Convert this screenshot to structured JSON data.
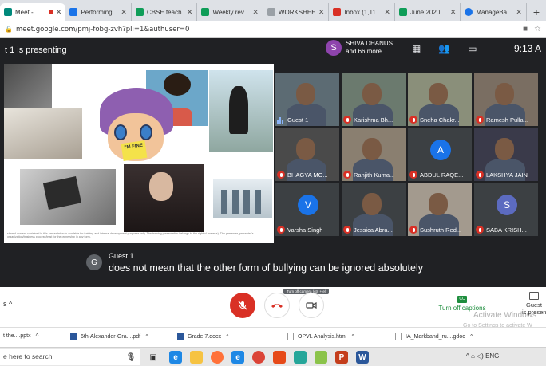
{
  "browser": {
    "tabs": [
      {
        "title": "Meet - ",
        "recording": true,
        "favicon_color": "#00897b",
        "active": true
      },
      {
        "title": "Performing",
        "favicon_color": "#1a73e8"
      },
      {
        "title": "CBSE teach",
        "favicon_color": "#0f9d58"
      },
      {
        "title": "Weekly rev",
        "favicon_color": "#0f9d58"
      },
      {
        "title": "WORKSHEE",
        "favicon_color": "#9aa0a6"
      },
      {
        "title": "Inbox (1,11",
        "favicon_color": "#d93025"
      },
      {
        "title": "June 2020",
        "favicon_color": "#0f9d58"
      },
      {
        "title": "ManageBa",
        "favicon_color": "#1a73e8"
      }
    ],
    "new_tab": "+",
    "url": "meet.google.com/pmj-fobg-zvh?pli=1&authuser=0"
  },
  "meet": {
    "presenting_label": "t 1 is presenting",
    "presenter": {
      "initial": "S",
      "name": "SHIVA DHANUS...",
      "more": "and 66 more"
    },
    "time": "9:13 A",
    "shared_caption": "shared content contained in this presentation is available for training and internal development purposes only. The training presentation belongs to the rightful owner(s). The presenter, presenter's organization/business process/trust for the ownership in any form.",
    "fine_card": "I'M FINE",
    "participants": [
      {
        "name": "Guest 1",
        "muted": false,
        "type": "video",
        "color": "#5c6b73"
      },
      {
        "name": "Karishma Bh...",
        "muted": true,
        "type": "video",
        "color": "#6b7a6e"
      },
      {
        "name": "Sneha Chakr...",
        "muted": true,
        "type": "video",
        "color": "#8a8f7a"
      },
      {
        "name": "Ramesh Pulla...",
        "muted": true,
        "type": "video",
        "color": "#7a6e62"
      },
      {
        "name": "BHAGYA MO...",
        "muted": true,
        "type": "video",
        "color": "#4a4a4a"
      },
      {
        "name": "Ranjith Kuma...",
        "muted": true,
        "type": "video",
        "color": "#8a7f70"
      },
      {
        "name": "ABDUL RAQE...",
        "muted": true,
        "type": "avatar",
        "initial": "A",
        "color": "#1a73e8"
      },
      {
        "name": "LAKSHYA JAIN",
        "muted": true,
        "type": "video",
        "color": "#3a3a4a"
      },
      {
        "name": "Varsha Singh",
        "muted": true,
        "type": "avatar",
        "initial": "V",
        "color": "#1a73e8"
      },
      {
        "name": "Jessica Abra...",
        "muted": true,
        "type": "video",
        "color": "#3c4043"
      },
      {
        "name": "Sushruth Red...",
        "muted": true,
        "type": "video",
        "color": "#a39a8e"
      },
      {
        "name": "SABA KRISH...",
        "muted": true,
        "type": "avatar",
        "initial": "S",
        "color": "#5c6bc0"
      }
    ],
    "caption": {
      "initial": "G",
      "speaker": "Guest 1",
      "text": "does not mean that the other form of bullying can be ignored absolutely"
    }
  },
  "controls": {
    "left_label": "s ^",
    "camera_tooltip": "Turn off camera (ctrl + e)",
    "captions_icon": "CC",
    "captions_label": "Turn off captions",
    "guest_label": "Guest",
    "guest_sub": "is present",
    "watermark": "Activate Windows",
    "watermark_sub": "Go to Settings to activate W"
  },
  "downloads": [
    {
      "name": "t the....pptx",
      "color": "#d35400"
    },
    {
      "name": "6th-Alexander-Gra....pdf",
      "color": "#2b579a"
    },
    {
      "name": "Grade 7.docx",
      "color": "#2b579a"
    },
    {
      "name": "OPVL Analysis.html",
      "color": "#9aa0a6"
    },
    {
      "name": "IA_Markband_ru....gdoc",
      "color": "#9aa0a6"
    }
  ],
  "taskbar": {
    "search_placeholder": "e here to search",
    "tray": "^ ⌂ ◁) ENG"
  }
}
